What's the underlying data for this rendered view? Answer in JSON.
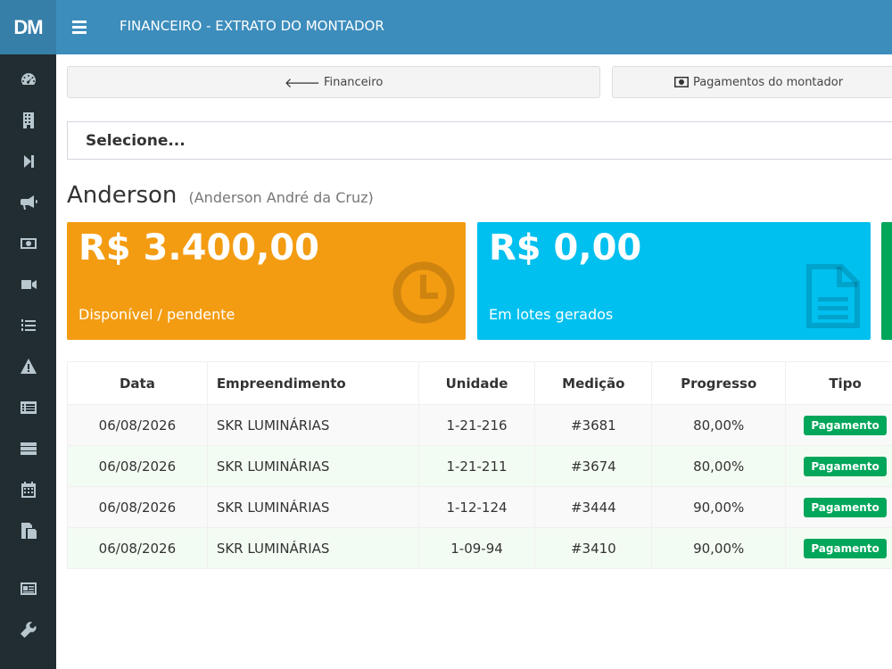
{
  "logo": {
    "text": "DM"
  },
  "header": {
    "title": "FINANCEIRO - EXTRATO DO MONTADOR"
  },
  "sidebar": {
    "items": [
      {
        "icon": "dashboard-icon"
      },
      {
        "icon": "building-icon"
      },
      {
        "icon": "step-forward-icon"
      },
      {
        "icon": "bullhorn-icon"
      },
      {
        "icon": "money-icon"
      },
      {
        "icon": "video-camera-icon"
      },
      {
        "icon": "list-ordered-icon"
      },
      {
        "icon": "warning-icon"
      },
      {
        "icon": "list-alt-icon"
      },
      {
        "icon": "server-icon"
      },
      {
        "icon": "calendar-icon"
      },
      {
        "icon": "copy-icon"
      },
      {
        "icon": "id-card-icon"
      },
      {
        "icon": "wrench-icon"
      }
    ]
  },
  "nav": {
    "back_label": "Financeiro",
    "payments_label": "Pagamentos do montador"
  },
  "select": {
    "value": "Selecione..."
  },
  "profile": {
    "name": "Anderson",
    "full_name": "(Anderson André da Cruz)"
  },
  "boxes": [
    {
      "amount": "R$ 3.400,00",
      "label": "Disponível / pendente",
      "color": "#f39c12"
    },
    {
      "amount": "R$ 0,00",
      "label": "Em lotes gerados",
      "color": "#00c0ef"
    },
    {
      "amount": "",
      "label": "",
      "color": "#00a65a"
    }
  ],
  "table": {
    "headers": [
      "Data",
      "Empreendimento",
      "Unidade",
      "Medição",
      "Progresso",
      "Tipo"
    ],
    "rows": [
      {
        "data": "06/08/2026",
        "empreendimento": "SKR LUMINÁRIAS",
        "unidade": "1-21-216",
        "medicao": "#3681",
        "progresso": "80,00%",
        "tipo": "Pagamento"
      },
      {
        "data": "06/08/2026",
        "empreendimento": "SKR LUMINÁRIAS",
        "unidade": "1-21-211",
        "medicao": "#3674",
        "progresso": "80,00%",
        "tipo": "Pagamento"
      },
      {
        "data": "06/08/2026",
        "empreendimento": "SKR LUMINÁRIAS",
        "unidade": "1-12-124",
        "medicao": "#3444",
        "progresso": "90,00%",
        "tipo": "Pagamento"
      },
      {
        "data": "06/08/2026",
        "empreendimento": "SKR LUMINÁRIAS",
        "unidade": "1-09-94",
        "medicao": "#3410",
        "progresso": "90,00%",
        "tipo": "Pagamento"
      }
    ]
  }
}
